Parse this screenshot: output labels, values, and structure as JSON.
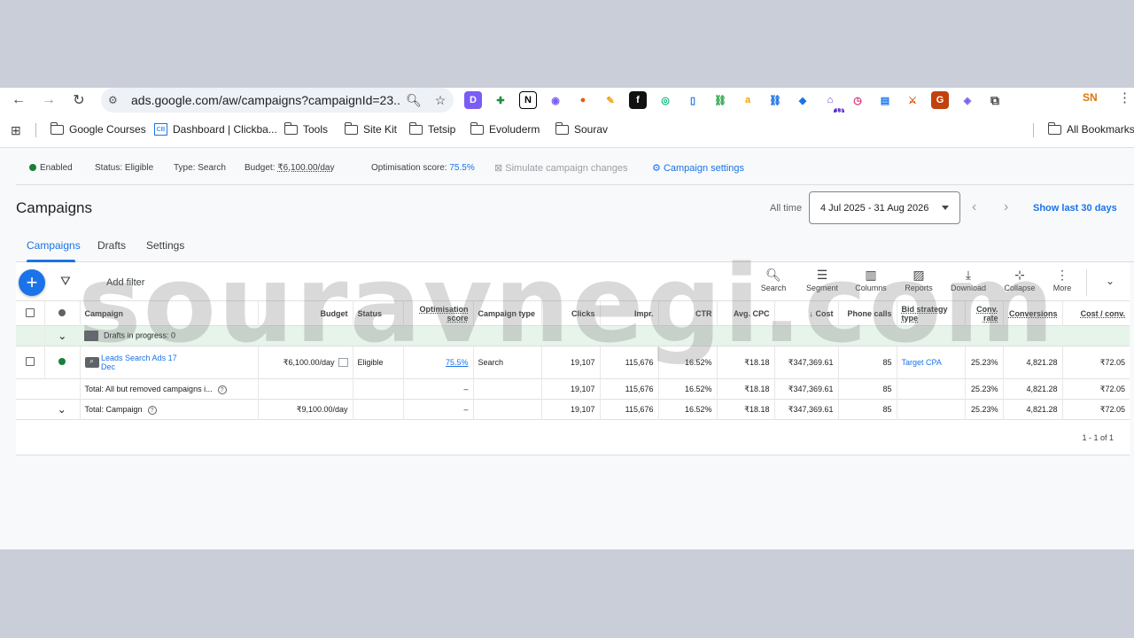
{
  "browser": {
    "url": "ads.google.com/aw/campaigns?campaignId=23...",
    "profile": "SN",
    "extensions_badge": "13"
  },
  "bookmarks": {
    "items": [
      "Google Courses",
      "Dashboard | Clickba...",
      "Tools",
      "Site Kit",
      "Tetsip",
      "Evoluderm",
      "Sourav"
    ],
    "all_bookmarks": "All Bookmarks"
  },
  "status_bar": {
    "enabled": "Enabled",
    "status": "Status: Eligible",
    "type_label": "Type:",
    "type_value": "Search",
    "budget_label": "Budget:",
    "budget_value": "₹6,100.00/day",
    "score_label": "Optimisation score:",
    "score_value": "75.5%",
    "simulate": "Simulate campaign changes",
    "settings": "Campaign settings"
  },
  "header": {
    "title": "Campaigns",
    "all_time": "All time",
    "date_range": "4 Jul 2025 - 31 Aug 2026",
    "show_last": "Show last 30 days"
  },
  "tabs": [
    "Campaigns",
    "Drafts",
    "Settings"
  ],
  "toolbar": {
    "add_filter": "Add filter",
    "tools": [
      "Search",
      "Segment",
      "Columns",
      "Reports",
      "Download",
      "Collapse",
      "More"
    ]
  },
  "table": {
    "columns": [
      "Campaign",
      "Budget",
      "Status",
      "Optimisation score",
      "Campaign type",
      "Clicks",
      "Impr.",
      "CTR",
      "Avg. CPC",
      "Cost",
      "Phone calls",
      "Bid strategy type",
      "Conv. rate",
      "Conversions",
      "Cost / conv."
    ],
    "drafts": "Drafts in progress: 0",
    "campaign_row": {
      "name": "Leads Search Ads 17 Dec",
      "budget": "₹6,100.00/day",
      "status": "Eligible",
      "score": "75.5%",
      "type": "Search",
      "clicks": "19,107",
      "impr": "115,676",
      "ctr": "16.52%",
      "avg_cpc": "₹18.18",
      "cost": "₹347,369.61",
      "phone_calls": "85",
      "bid_strategy": "Target CPA",
      "conv_rate": "25.23%",
      "conversions": "4,821.28",
      "cost_conv": "₹72.05"
    },
    "total_removed": {
      "label": "Total: All but removed campaigns i...",
      "score": "–",
      "clicks": "19,107",
      "impr": "115,676",
      "ctr": "16.52%",
      "avg_cpc": "₹18.18",
      "cost": "₹347,369.61",
      "phone_calls": "85",
      "conv_rate": "25.23%",
      "conversions": "4,821.28",
      "cost_conv": "₹72.05"
    },
    "total_campaign": {
      "label": "Total: Campaign",
      "budget": "₹9,100.00/day",
      "score": "–",
      "clicks": "19,107",
      "impr": "115,676",
      "ctr": "16.52%",
      "avg_cpc": "₹18.18",
      "cost": "₹347,369.61",
      "phone_calls": "85",
      "conv_rate": "25.23%",
      "conversions": "4,821.28",
      "cost_conv": "₹72.05"
    },
    "pager": "1 - 1 of 1"
  },
  "watermark": "souravnegi.com"
}
